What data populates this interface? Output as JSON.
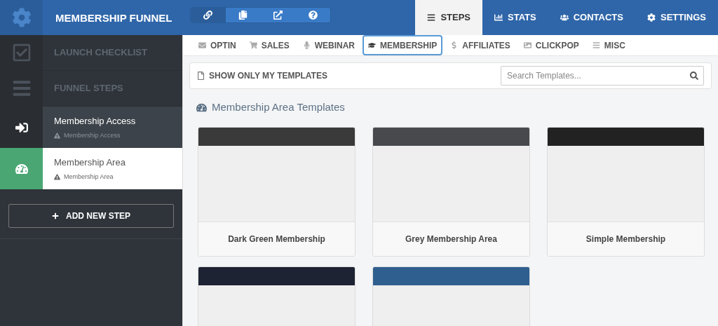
{
  "header": {
    "title": "MEMBERSHIP FUNNEL",
    "tools": [
      {
        "kind": "link",
        "selected": true
      },
      {
        "kind": "copy",
        "selected": false
      },
      {
        "kind": "external",
        "selected": false
      },
      {
        "kind": "help",
        "selected": false
      }
    ],
    "nav": [
      {
        "kind": "steps",
        "label": "STEPS",
        "selected": true
      },
      {
        "kind": "stats",
        "label": "STATS",
        "selected": false
      },
      {
        "kind": "contacts",
        "label": "CONTACTS",
        "selected": false
      },
      {
        "kind": "settings",
        "label": "SETTINGS",
        "selected": false
      }
    ]
  },
  "sidebar": {
    "sections": [
      {
        "kind": "checklist",
        "label": "LAUNCH CHECKLIST"
      },
      {
        "kind": "steps",
        "label": "FUNNEL STEPS"
      }
    ],
    "steps": [
      {
        "kind": "access",
        "title": "Membership Access",
        "subtitle": "Membership Access",
        "selected": false
      },
      {
        "kind": "area",
        "title": "Membership Area",
        "subtitle": "Membership Area",
        "selected": true
      }
    ],
    "add_button": "ADD NEW STEP"
  },
  "categories": [
    {
      "kind": "optin",
      "label": "OPTIN",
      "selected": false
    },
    {
      "kind": "sales",
      "label": "SALES",
      "selected": false
    },
    {
      "kind": "webinar",
      "label": "WEBINAR",
      "selected": false
    },
    {
      "kind": "membership",
      "label": "MEMBERSHIP",
      "selected": true
    },
    {
      "kind": "affiliates",
      "label": "AFFILIATES",
      "selected": false
    },
    {
      "kind": "clickpop",
      "label": "CLICKPOP",
      "selected": false
    },
    {
      "kind": "misc",
      "label": "MISC",
      "selected": false
    }
  ],
  "filter": {
    "label": "SHOW ONLY MY TEMPLATES",
    "search_placeholder": "Search Templates..."
  },
  "section_title": "Membership Area Templates",
  "templates": [
    {
      "name": "Dark Green Membership",
      "kind": "dark"
    },
    {
      "name": "Grey Membership Area",
      "kind": "grey"
    },
    {
      "name": "Simple Membership",
      "kind": "black"
    },
    {
      "kind": "navy"
    },
    {
      "kind": "blue"
    }
  ]
}
